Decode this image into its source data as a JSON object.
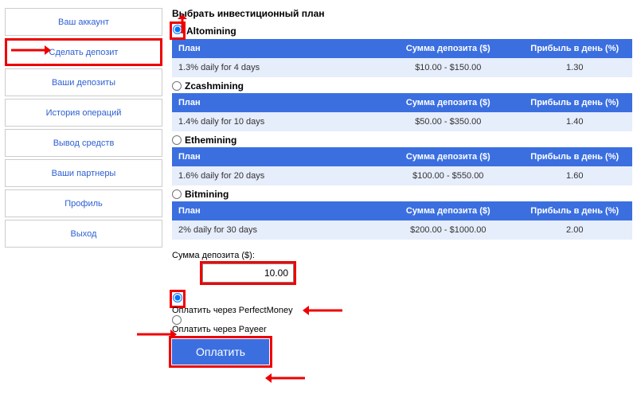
{
  "sidebar": {
    "items": [
      {
        "label": "Ваш аккаунт"
      },
      {
        "label": "Сделать депозит"
      },
      {
        "label": "Ваши депозиты"
      },
      {
        "label": "История операций"
      },
      {
        "label": "Вывод средств"
      },
      {
        "label": "Ваши партнеры"
      },
      {
        "label": "Профиль"
      },
      {
        "label": "Выход"
      }
    ]
  },
  "main": {
    "title": "Выбрать инвестиционный план",
    "headers": {
      "plan": "План",
      "deposit": "Сумма депозита ($)",
      "profit": "Прибыль в день (%)"
    },
    "plans": [
      {
        "name": "Altomining",
        "desc": "1.3% daily for 4 days",
        "range": "$10.00 - $150.00",
        "profit": "1.30",
        "checked": true
      },
      {
        "name": "Zcashmining",
        "desc": "1.4% daily for 10 days",
        "range": "$50.00 - $350.00",
        "profit": "1.40",
        "checked": false
      },
      {
        "name": "Ethemining",
        "desc": "1.6% daily for 20 days",
        "range": "$100.00 - $550.00",
        "profit": "1.60",
        "checked": false
      },
      {
        "name": "Bitmining",
        "desc": "2% daily for 30 days",
        "range": "$200.00 - $1000.00",
        "profit": "2.00",
        "checked": false
      }
    ],
    "deposit": {
      "label": "Сумма депозита ($):",
      "value": "10.00"
    },
    "pay": {
      "options": [
        {
          "label": "Оплатить через PerfectMoney",
          "checked": true
        },
        {
          "label": "Оплатить через Payeer",
          "checked": false
        }
      ],
      "button": "Оплатить"
    }
  },
  "colors": {
    "accent": "#3b6fe0",
    "highlight": "#e00"
  }
}
